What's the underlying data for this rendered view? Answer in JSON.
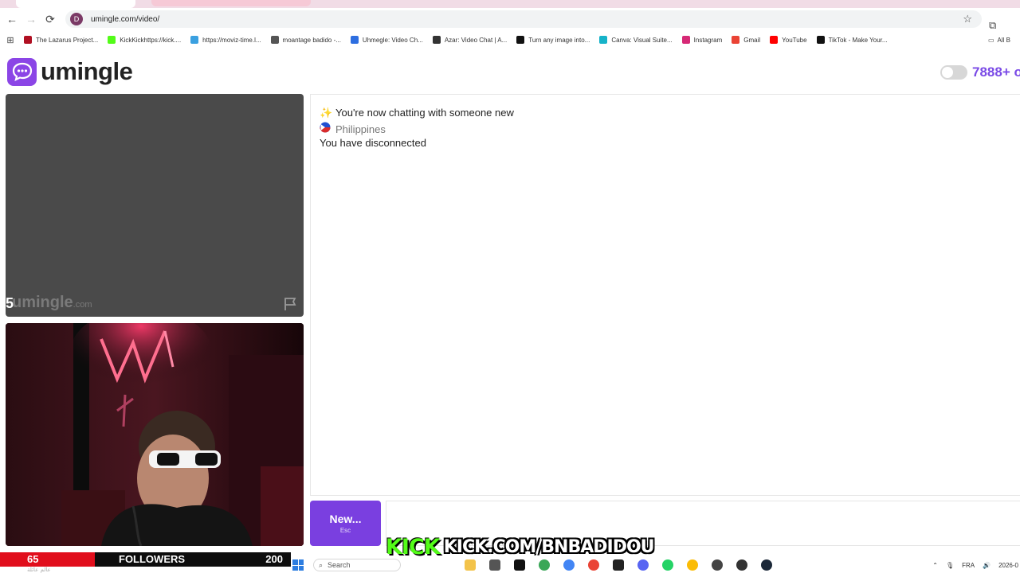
{
  "browser": {
    "url": "umingle.com/video/",
    "bookmarks": [
      {
        "label": "The Lazarus Project...",
        "color": "#b01022"
      },
      {
        "label": "KickKickhttps://kick....",
        "color": "#53fc18"
      },
      {
        "label": "https://moviz-time.l...",
        "color": "#3aa0e0"
      },
      {
        "label": "moantage badido -...",
        "color": "#555555"
      },
      {
        "label": "Uhmegle: Video Ch...",
        "color": "#2d6ee0"
      },
      {
        "label": "Azar: Video Chat | A...",
        "color": "#333333"
      },
      {
        "label": "Turn any image into...",
        "color": "#111111"
      },
      {
        "label": "Canva: Visual Suite...",
        "color": "#16b3c9"
      },
      {
        "label": "Instagram",
        "color": "#d62976"
      },
      {
        "label": "Gmail",
        "color": "#ea4335"
      },
      {
        "label": "YouTube",
        "color": "#ff0000"
      },
      {
        "label": "TikTok - Make Your...",
        "color": "#111111"
      }
    ],
    "all_bookmarks": "All B"
  },
  "site": {
    "logo_text": "umingle",
    "online_count": "7888+ o",
    "accent": "#7a3fe0"
  },
  "stranger_video": {
    "watermark_main": "umingle",
    "watermark_suffix": ".com",
    "overlay_char": "5"
  },
  "chat": {
    "messages": [
      {
        "emoji": "sparkles-icon",
        "text": "You're now chatting with someone new"
      },
      {
        "emoji": "philippines-flag-icon",
        "text": "Philippines"
      },
      {
        "emoji": "",
        "text": "You have disconnected"
      }
    ]
  },
  "controls": {
    "new_label": "New...",
    "new_hint": "Esc"
  },
  "stream_overlay": {
    "kick_logo": "KICK",
    "kick_url": "KICK.COM/BNBADIDOU",
    "followers_current": "65",
    "followers_label": "FOLLOWERS",
    "followers_goal": "200",
    "followers_progress": 0.325,
    "caption_arabic": "عالم عائلة"
  },
  "taskbar": {
    "search_placeholder": "Search",
    "language": "FRA",
    "date": "2026-0"
  }
}
